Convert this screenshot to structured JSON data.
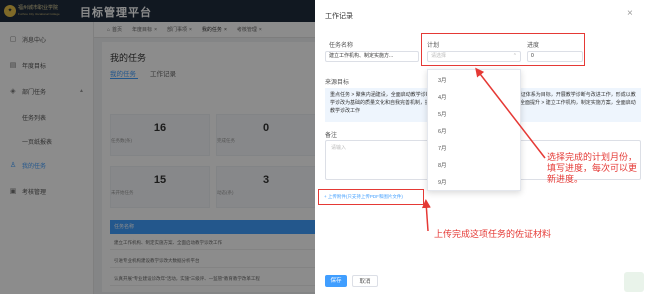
{
  "app": {
    "logo_cn": "福州城市职业学院",
    "logo_en": "Fuzhou City Vocational College",
    "title": "目标管理平台"
  },
  "sidebar": {
    "items": [
      {
        "label": "消息中心",
        "icon": "bell-icon"
      },
      {
        "label": "年度目标",
        "icon": "calendar-icon"
      },
      {
        "label": "部门任务",
        "icon": "layers-icon"
      },
      {
        "label": "任务列表",
        "icon": ""
      },
      {
        "label": "一页纸报表",
        "icon": ""
      },
      {
        "label": "我的任务",
        "icon": "user-icon"
      },
      {
        "label": "考核管理",
        "icon": "clipboard-icon"
      }
    ]
  },
  "tabs": [
    "首页",
    "年度目标",
    "部门事项",
    "我的任务",
    "考核管理"
  ],
  "page": {
    "title": "我的任务",
    "subtabs": [
      "我的任务",
      "工作记录"
    ],
    "stats": [
      {
        "value": "16",
        "label": "任务数(条)"
      },
      {
        "value": "0",
        "label": "完成任务"
      },
      {
        "value": "15",
        "label": "未开始任务"
      },
      {
        "value": "3",
        "label": "动态(条)"
      }
    ],
    "task_header": "任务名称",
    "tasks": [
      "建立工作机构、制定实施方案、全面启动教学诊改工作",
      "引进专业机构建设教学诊改大数据分析平台",
      "认真开展\"专业建设诊改年\"活动，实施\"三级评、一监管\"教育教学改革工程"
    ]
  },
  "dialog": {
    "title": "工作记录",
    "task_label": "任务名称",
    "task_value": "建立工作机构、制定实施方...",
    "plan_label": "计划",
    "plan_placeholder": "请选择",
    "progress_label": "进度",
    "progress_value": "0",
    "months": [
      "3月",
      "4月",
      "5月",
      "6月",
      "7月",
      "8月",
      "9月"
    ],
    "source_label": "来源目标",
    "source_text": "重点任务 > 聚焦内涵建设，全面启动教学诊断与改进工作，以建立常态化的内部质量保证体系为目标，开展教学诊断与改进工作，形成以教学诊改为基础的质量文化和自我完善机制，提升办学活力和人才培养质量和治理能力的全面提升 > 建立工作机构，制定实施方案，全面启动教学诊改工作",
    "remark_label": "备注",
    "remark_placeholder": "请输入",
    "upload_label": "+ 上传附件(只支持上传PDF和图片文件)",
    "save_label": "保存",
    "cancel_label": "取消"
  },
  "annotations": {
    "plan_note": "选择完成的计划月份，填写进度，每次可以更新进度。",
    "upload_note": "上传完成这项任务的佐证材料"
  }
}
